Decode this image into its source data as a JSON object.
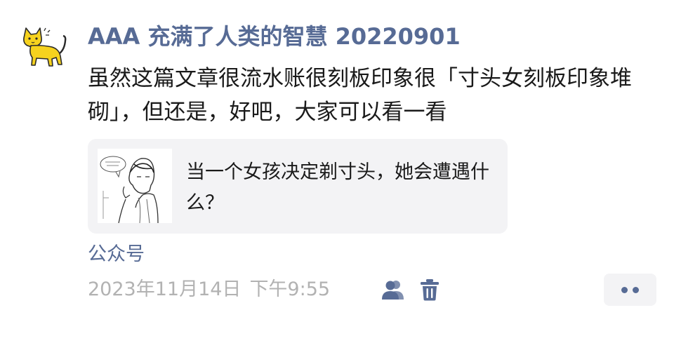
{
  "post": {
    "author": "AAA 充满了人类的智慧 20220901",
    "text": "虽然这篇文章很流水账很刻板印象很「寸头女刻板印象堆砌」，但还是，好吧，大家可以看一看",
    "avatar_icon": "yellow-cat-icon"
  },
  "card": {
    "title": "当一个女孩决定剃寸头，她会遭遇什么？",
    "thumbnail": "sketch-illustration"
  },
  "source": "公众号",
  "meta": {
    "date": "2023年11月14日",
    "time": "下午9:55",
    "visibility_icon": "friends-icon",
    "delete_icon": "trash-icon",
    "more_icon": "more-dots-icon"
  },
  "colors": {
    "link": "#576b95",
    "text": "#1a1a1a",
    "meta": "#b2b2b2",
    "card_bg": "#f3f3f5"
  }
}
